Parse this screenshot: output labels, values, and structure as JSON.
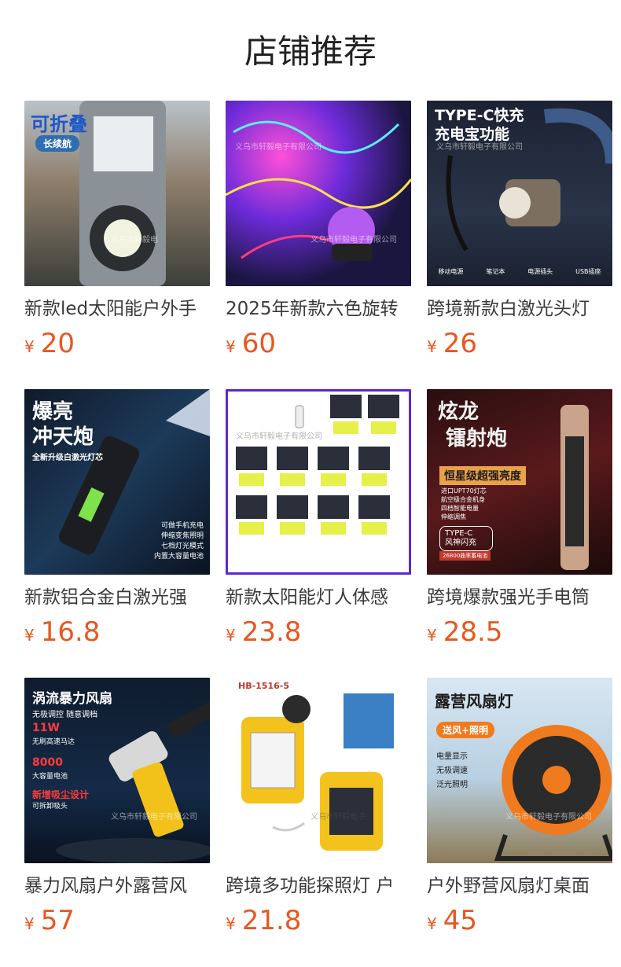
{
  "header": {
    "title": "店铺推荐"
  },
  "currency_symbol": "¥",
  "products": [
    {
      "title": "新款led太阳能户外手",
      "price": "20",
      "image_text": [
        "可折叠",
        "长续航",
        "义乌市轩毅电"
      ]
    },
    {
      "title": "2025年新款六色旋转",
      "price": "60",
      "image_text": [
        "义乌市轩毅电子有限公司",
        "义乌市轩毅电子有限公司"
      ]
    },
    {
      "title": "跨境新款白激光头灯",
      "price": "26",
      "image_text": [
        "TYPE-C快充",
        "充电宝功能",
        "义乌市轩毅电子有限公司",
        "移动电源",
        "笔记本",
        "电源插头",
        "USB插座"
      ]
    },
    {
      "title": "新款铝合金白激光强",
      "price": "16.8",
      "image_text": [
        "爆亮",
        "冲天炮",
        "全新升级白激光灯芯",
        "可做手机充电",
        "伸缩变焦照明",
        "七档灯光模式",
        "内置大容量电池"
      ]
    },
    {
      "title": "新款太阳能灯人体感",
      "price": "23.8",
      "image_text": [
        "义乌市轩毅电子有限公司"
      ]
    },
    {
      "title": "跨境爆款强光手电筒",
      "price": "28.5",
      "image_text": [
        "炫龙",
        "镭射炮",
        "恒星级超强亮度",
        "进口UPT70灯芯",
        "航空级合金机身",
        "四档智能电量",
        "伸缩调焦",
        "TYPE-C",
        "风神闪充",
        "26800曲率蓄电池"
      ]
    },
    {
      "title": "暴力风扇户外露营风",
      "price": "57",
      "image_text": [
        "涡流暴力风扇",
        "无极调控 随意调档",
        "11W",
        "无刷高速马达",
        "8000",
        "大容量电池",
        "新增吸尘设计",
        "可拆卸吸头",
        "义乌市轩毅电子有限公司"
      ]
    },
    {
      "title": "跨境多功能探照灯 户",
      "price": "21.8",
      "image_text": [
        "HB-1516-5",
        "义乌市轩毅电子"
      ]
    },
    {
      "title": "户外野营风扇灯桌面",
      "price": "45",
      "image_text": [
        "露营风扇灯",
        "送风+照明",
        "电量显示",
        "无极调速",
        "泛光照明",
        "义乌市轩毅电子有限公司"
      ]
    }
  ]
}
